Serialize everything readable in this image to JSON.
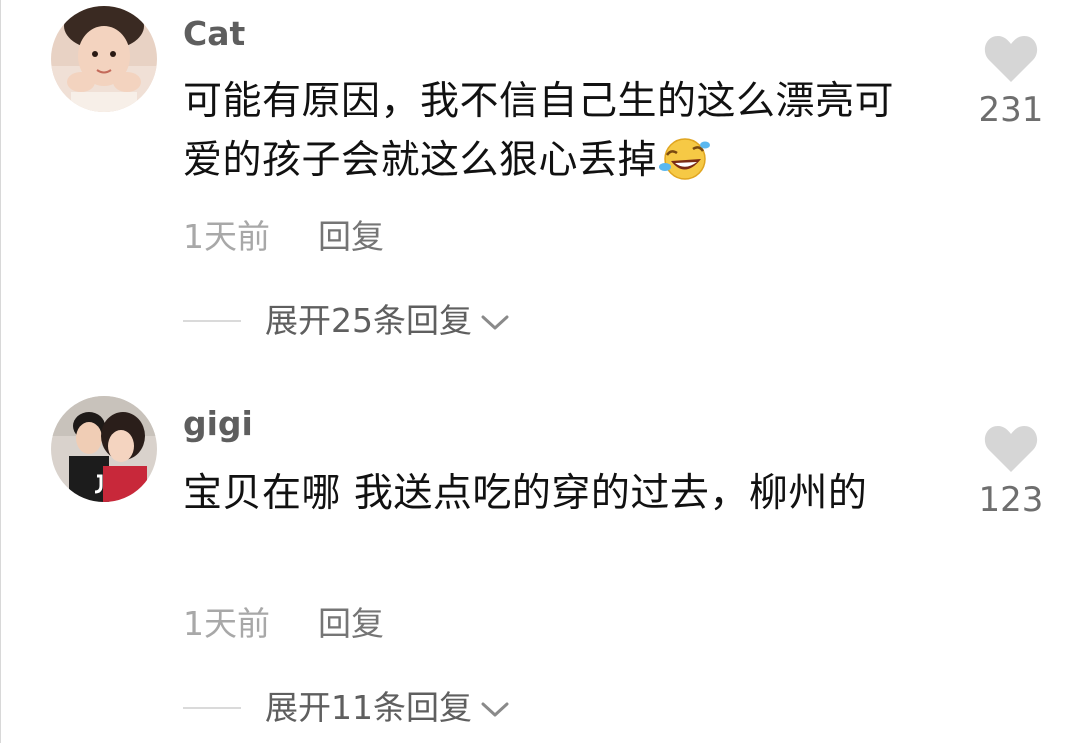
{
  "comments": [
    {
      "username": "Cat",
      "text": "可能有原因，我不信自己生的这么漂亮可爱的孩子会就这么狠心丢掉",
      "emoji": "rofl-emoji",
      "time": "1天前",
      "reply_label": "回复",
      "likes": "231",
      "expand_label": "展开25条回复"
    },
    {
      "username": "gigi",
      "text": "宝贝在哪 我送点吃的穿的过去，柳州的",
      "time": "1天前",
      "reply_label": "回复",
      "likes": "123",
      "expand_label": "展开11条回复"
    }
  ],
  "colors": {
    "username": "#5e5e5e",
    "text": "#111111",
    "meta": "#a8a8a8",
    "heart": "#d6d6d6"
  }
}
